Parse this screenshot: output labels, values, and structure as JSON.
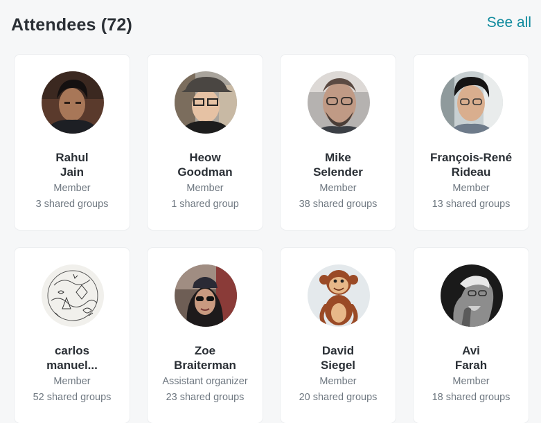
{
  "header": {
    "title": "Attendees (72)",
    "see_all": "See all"
  },
  "attendees": [
    {
      "first": "Rahul",
      "last": "Jain",
      "role": "Member",
      "groups": "3 shared groups",
      "avatar_icon": "person-photo-icon"
    },
    {
      "first": "Heow",
      "last": "Goodman",
      "role": "Member",
      "groups": "1 shared group",
      "avatar_icon": "person-photo-icon"
    },
    {
      "first": "Mike",
      "last": "Selender",
      "role": "Member",
      "groups": "38 shared groups",
      "avatar_icon": "person-photo-icon"
    },
    {
      "first": "François-René",
      "last": "Rideau",
      "role": "Member",
      "groups": "13 shared groups",
      "avatar_icon": "person-photo-icon"
    },
    {
      "first": "carlos",
      "last": "manuel...",
      "role": "Member",
      "groups": "52 shared groups",
      "avatar_icon": "sketch-drawing-icon"
    },
    {
      "first": "Zoe",
      "last": "Braiterman",
      "role": "Assistant organizer",
      "groups": "23 shared groups",
      "avatar_icon": "person-photo-icon"
    },
    {
      "first": "David",
      "last": "Siegel",
      "role": "Member",
      "groups": "20 shared groups",
      "avatar_icon": "cartoon-monkey-icon"
    },
    {
      "first": "Avi",
      "last": "Farah",
      "role": "Member",
      "groups": "18 shared groups",
      "avatar_icon": "person-photo-icon"
    }
  ],
  "colors": {
    "accent": "#0f8a9d",
    "background": "#f6f7f8",
    "card": "#ffffff",
    "muted_text": "#6f7881"
  }
}
